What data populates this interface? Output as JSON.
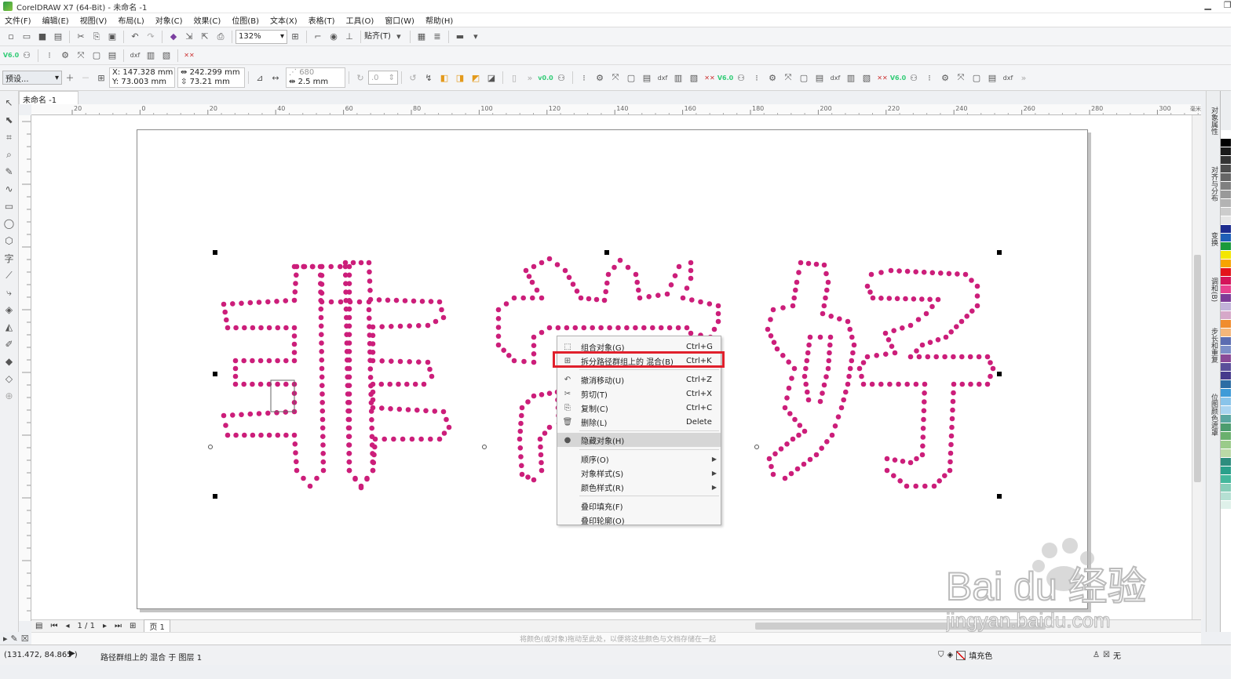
{
  "app": {
    "title": "CorelDRAW X7 (64-Bit) - 未命名 -1",
    "window_buttons": [
      "▁",
      "❐",
      "✕"
    ]
  },
  "menu": [
    "文件(F)",
    "编辑(E)",
    "视图(V)",
    "布局(L)",
    "对象(C)",
    "效果(C)",
    "位图(B)",
    "文本(X)",
    "表格(T)",
    "工具(O)",
    "窗口(W)",
    "帮助(H)"
  ],
  "toolbar": {
    "zoom": "132%",
    "snap_label": "贴齐(T)"
  },
  "propbar": {
    "preset": "预设...",
    "x": "X: 147.328 mm",
    "y": "Y: 73.003 mm",
    "w": "242.299 mm",
    "h": "73.21 mm",
    "steps": "680",
    "spacing": "2.5 mm",
    "angle": ".0",
    "vec": "v0.0"
  },
  "document": {
    "tab": "未命名 -1"
  },
  "ruler": {
    "h_ticks": [
      "20",
      "0",
      "20",
      "40",
      "60",
      "80",
      "100",
      "120",
      "140",
      "160",
      "180",
      "200",
      "220",
      "240",
      "260",
      "280",
      "300"
    ],
    "h_unit": "毫米"
  },
  "art": {
    "color": "#cc1e7a",
    "text": "非常好"
  },
  "context_menu": {
    "items": [
      {
        "label": "组合对象(G)",
        "shortcut": "Ctrl+G",
        "icon": "group-icon"
      },
      {
        "label": "拆分路径群组上的 混合(B)",
        "shortcut": "Ctrl+K",
        "icon": "break-apart-icon"
      },
      {
        "label": "撤消移动(U)",
        "shortcut": "Ctrl+Z",
        "icon": "undo-icon"
      },
      {
        "label": "剪切(T)",
        "shortcut": "Ctrl+X",
        "icon": "scissors-icon"
      },
      {
        "label": "复制(C)",
        "shortcut": "Ctrl+C",
        "icon": "copy-icon"
      },
      {
        "label": "删除(L)",
        "shortcut": "Delete",
        "icon": "trash-icon"
      },
      {
        "label": "隐藏对象(H)",
        "shortcut": "",
        "icon": "eye-icon"
      },
      {
        "label": "顺序(O)",
        "shortcut": "",
        "icon": ""
      },
      {
        "label": "对象样式(S)",
        "shortcut": "",
        "icon": ""
      },
      {
        "label": "颜色样式(R)",
        "shortcut": "",
        "icon": ""
      },
      {
        "label": "叠印填充(F)",
        "shortcut": "",
        "icon": ""
      },
      {
        "label": "叠印轮廓(O)",
        "shortcut": "",
        "icon": ""
      }
    ],
    "highlight_color": "#e0202c"
  },
  "page_nav": {
    "counter": "1 / 1",
    "page_tab": "页 1"
  },
  "hint": "将颜色(或对象)拖动至此处，以便将这些颜色与文档存储在一起",
  "status": {
    "coords": "(131.472, 84.865 )",
    "info": "路径群组上的 混合 于 图层 1",
    "fill": "填充色",
    "outline": "无"
  },
  "dockers": [
    "对象属性",
    "对齐与分布",
    "变换",
    "调和(B)",
    "步长和重复",
    "位图颜色遮罩"
  ],
  "palette": [
    "#ffffff",
    "#000000",
    "#1a1a1a",
    "#333333",
    "#4d4d4d",
    "#666666",
    "#808080",
    "#999999",
    "#b3b3b3",
    "#cccccc",
    "#e6e6e6",
    "#1d2c8f",
    "#1f5fb7",
    "#1a9a3c",
    "#f3e600",
    "#f7a400",
    "#e3141b",
    "#d4145a",
    "#e8418f",
    "#7d3c98",
    "#c2b2d9",
    "#d6a8c9",
    "#f08c2f",
    "#f5b67a",
    "#5b6cb1",
    "#7c8fc8",
    "#8a4a97",
    "#5a4f9a",
    "#463a8c",
    "#2d6da4",
    "#3e9bd8",
    "#89c4ea",
    "#a9d4f0",
    "#5aa7a1",
    "#4c9d6e",
    "#6ab06e",
    "#9acb8a",
    "#bad9a6",
    "#2d8d7e",
    "#2aa08b",
    "#43b79c",
    "#86cdb8",
    "#b5e0d3",
    "#dff1ea"
  ],
  "watermark": {
    "brand": "Bai du 经验",
    "url": "jingyan.baidu.com"
  }
}
